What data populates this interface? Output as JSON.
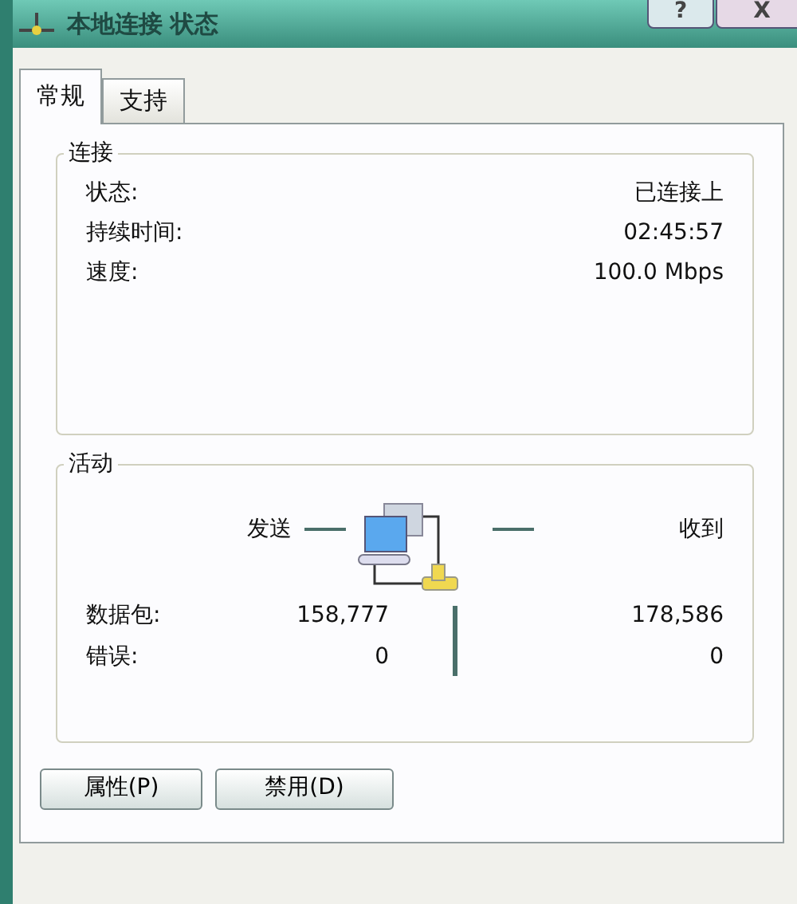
{
  "window": {
    "title": "本地连接 状态",
    "controls": [
      "?",
      "X"
    ]
  },
  "tabs": [
    {
      "label": "常规",
      "selected": true
    },
    {
      "label": "支持",
      "selected": false
    }
  ],
  "connection": {
    "title": "连接",
    "rows": [
      {
        "label": "状态:",
        "value": "已连接上"
      },
      {
        "label": "持续时间:",
        "value": "02:45:57"
      },
      {
        "label": "速度:",
        "value": "100.0 Mbps"
      }
    ]
  },
  "activity": {
    "title": "活动",
    "sent_label": "发送",
    "received_label": "收到",
    "rows": [
      {
        "label": "数据包:",
        "sent": "158,777",
        "received": "178,586"
      },
      {
        "label": "错误:",
        "sent": "0",
        "received": "0"
      }
    ]
  },
  "buttons": [
    "属性(P)",
    "禁用(D)"
  ]
}
